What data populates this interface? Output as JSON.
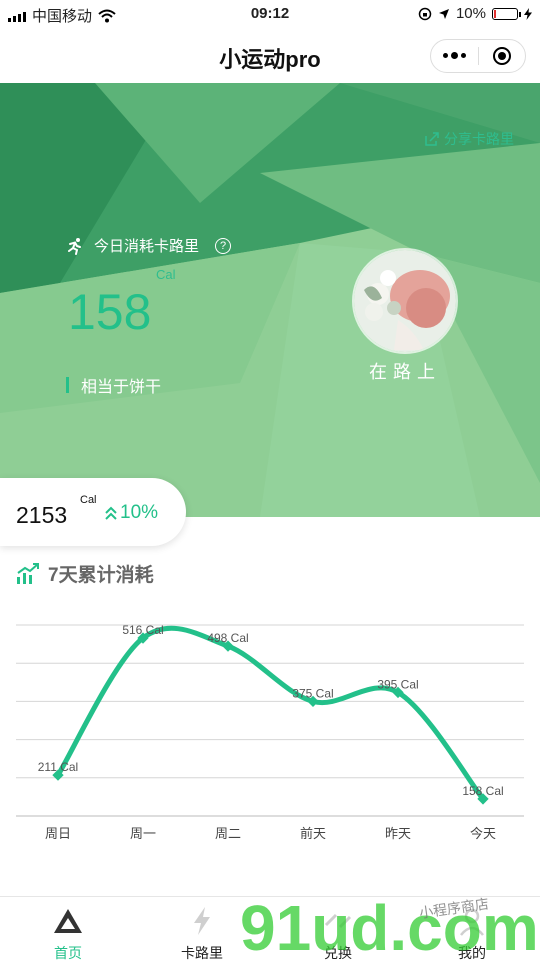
{
  "status_bar": {
    "carrier": "中国移动",
    "time": "09:12",
    "battery_percent": "10%",
    "battery_level": 0.1
  },
  "title_bar": {
    "title": "小运动pro"
  },
  "hero": {
    "share_label": "分享卡路里",
    "today_label": "今日消耗卡路里",
    "help_symbol": "?",
    "cal_unit": "Cal",
    "today_calories": "158",
    "equivalent_label": "相当于饼干",
    "avatar_caption": "在路上"
  },
  "total": {
    "value": "2153",
    "unit": "Cal",
    "change": "10%"
  },
  "section": {
    "title": "7天累计消耗"
  },
  "chart_data": {
    "type": "line",
    "categories": [
      "周日",
      "周一",
      "周二",
      "前天",
      "昨天",
      "今天"
    ],
    "values": [
      211,
      516,
      498,
      375,
      395,
      158
    ],
    "data_labels": [
      "211 Cal",
      "516 Cal",
      "498 Cal",
      "375 Cal",
      "395 Cal",
      "158 Cal"
    ],
    "ylim": [
      120,
      545
    ],
    "grid": true,
    "line_color": "#23c08a"
  },
  "tab_bar": {
    "items": [
      {
        "label": "首页",
        "icon": "triangle-icon",
        "active": true
      },
      {
        "label": "卡路里",
        "icon": "lightning-icon",
        "active": false
      },
      {
        "label": "兑换",
        "icon": "exchange-icon",
        "active": false
      },
      {
        "label": "我的",
        "icon": "user-icon",
        "active": false
      }
    ]
  },
  "watermark": {
    "text": "91ud.com",
    "subtext": "小程序商店"
  },
  "colors": {
    "accent": "#23c08a",
    "hero_light": "#8fce95",
    "hero_dark": "#3a9e64"
  }
}
